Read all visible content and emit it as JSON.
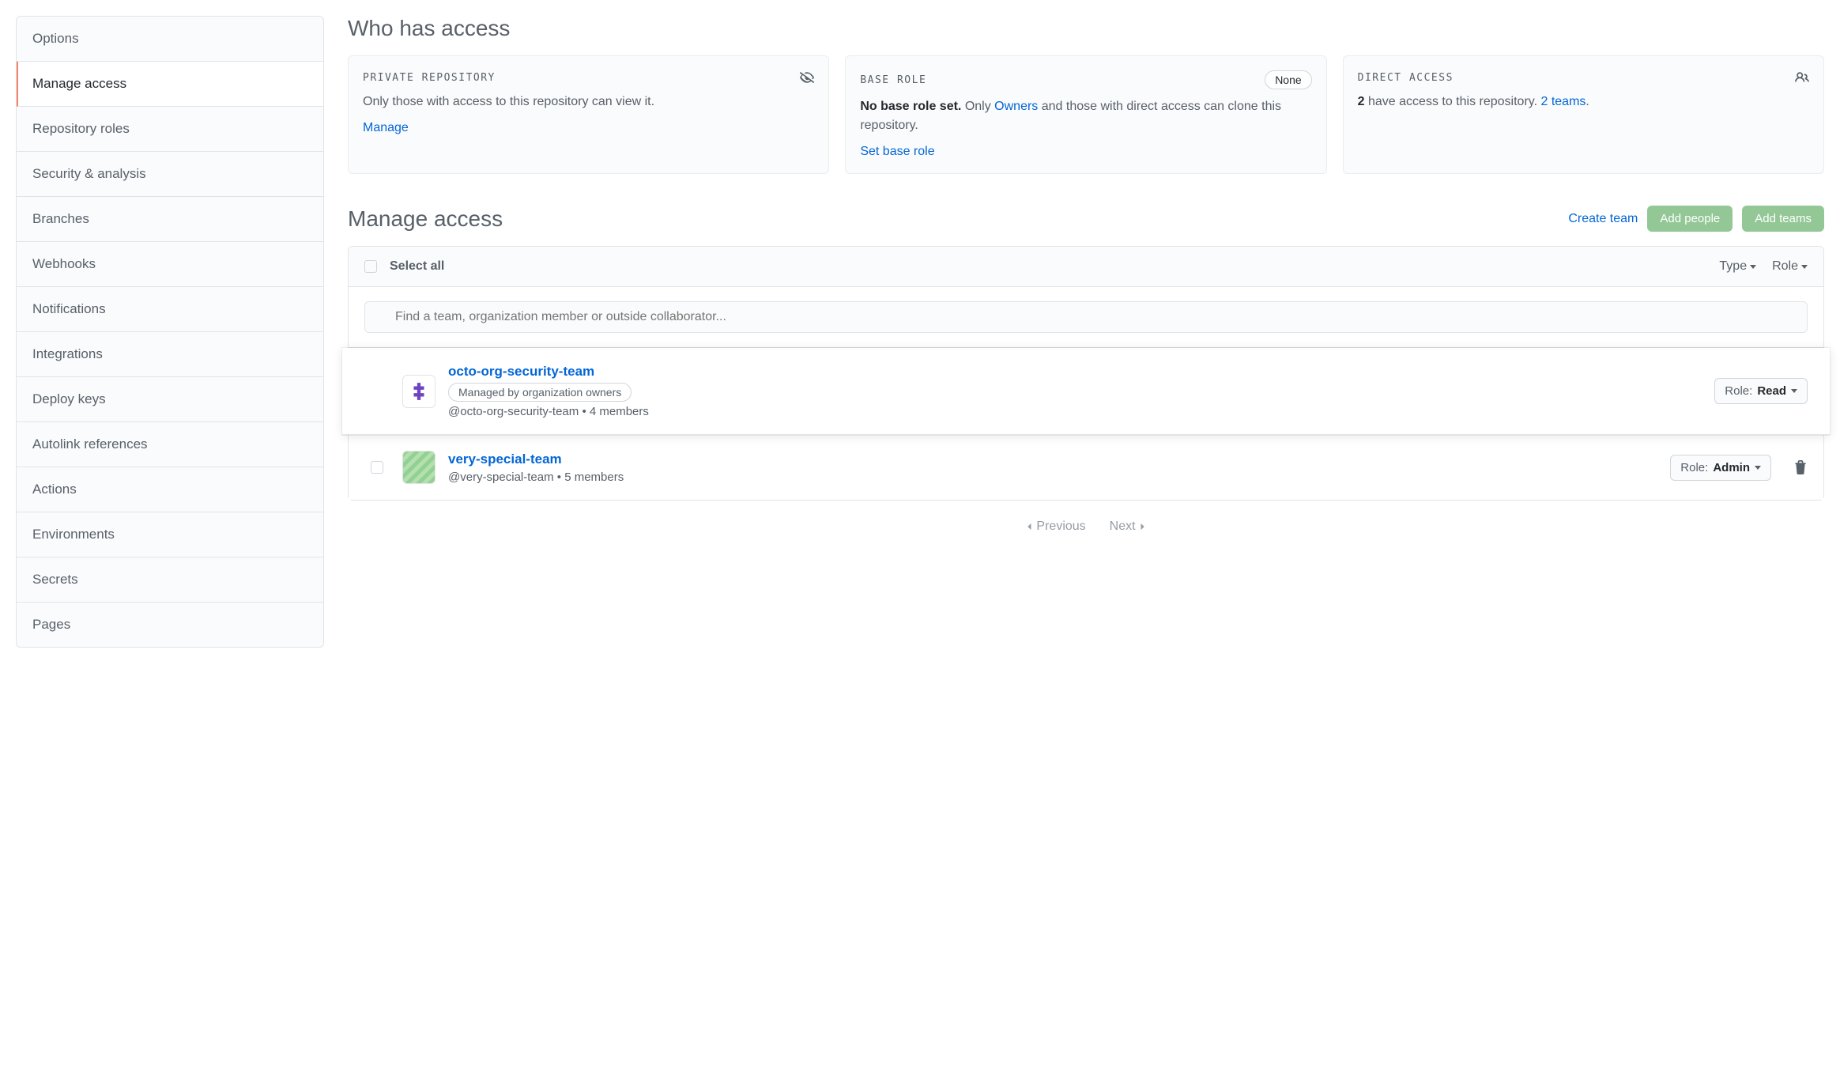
{
  "sidebar": {
    "items": [
      {
        "label": "Options"
      },
      {
        "label": "Manage access"
      },
      {
        "label": "Repository roles"
      },
      {
        "label": "Security & analysis"
      },
      {
        "label": "Branches"
      },
      {
        "label": "Webhooks"
      },
      {
        "label": "Notifications"
      },
      {
        "label": "Integrations"
      },
      {
        "label": "Deploy keys"
      },
      {
        "label": "Autolink references"
      },
      {
        "label": "Actions"
      },
      {
        "label": "Environments"
      },
      {
        "label": "Secrets"
      },
      {
        "label": "Pages"
      }
    ]
  },
  "who_access": {
    "title": "Who has access",
    "private": {
      "title": "PRIVATE REPOSITORY",
      "text": "Only those with access to this repository can view it.",
      "link": "Manage"
    },
    "base_role": {
      "title": "BASE ROLE",
      "badge": "None",
      "strong": "No base role set.",
      "text_prefix": " Only ",
      "owners_link": "Owners",
      "text_suffix": " and those with direct access can clone this repository.",
      "link": "Set base role"
    },
    "direct": {
      "title": "DIRECT ACCESS",
      "count": "2",
      "text": " have access to this repository. ",
      "link": "2 teams",
      "period": "."
    }
  },
  "manage": {
    "title": "Manage access",
    "create_team": "Create team",
    "add_people": "Add people",
    "add_teams": "Add teams",
    "select_all": "Select all",
    "type_filter": "Type",
    "role_filter": "Role",
    "search_placeholder": "Find a team, organization member or outside collaborator...",
    "teams": [
      {
        "name": "octo-org-security-team",
        "badge": "Managed by organization owners",
        "handle": "@octo-org-security-team",
        "members": "4 members",
        "role_prefix": "Role: ",
        "role_value": "Read"
      },
      {
        "name": "very-special-team",
        "handle": "@very-special-team",
        "members": "5 members",
        "role_prefix": "Role: ",
        "role_value": "Admin"
      }
    ],
    "pagination": {
      "prev": "Previous",
      "next": "Next"
    }
  }
}
